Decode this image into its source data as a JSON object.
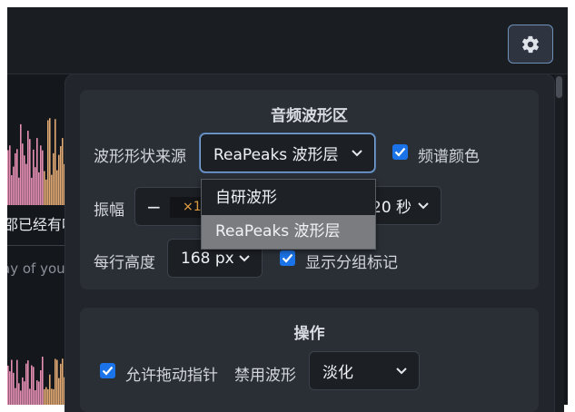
{
  "toolbar": {
    "settings_icon": "gear-icon"
  },
  "background": {
    "line1": "邵已经有听",
    "line2": "ay of you"
  },
  "waveform_section": {
    "title": "音频波形区",
    "source_label": "波形形状来源",
    "source_value": "ReaPeaks 波形层",
    "spectrum_color_label": "频谱颜色",
    "spectrum_color_checked": true,
    "amplitude_label": "振幅",
    "amplitude_minus": "−",
    "amplitude_value": "×1",
    "duration_value": "20 秒",
    "row_height_label": "每行高度",
    "row_height_value": "168 px",
    "group_markers_label": "显示分组标记",
    "group_markers_checked": true
  },
  "source_dropdown": {
    "options": [
      "自研波形",
      "ReaPeaks 波形层"
    ],
    "highlighted": "ReaPeaks 波形层"
  },
  "actions_section": {
    "title": "操作",
    "allow_drag_label": "允许拖动指针",
    "allow_drag_checked": true,
    "disabled_wave_label": "禁用波形",
    "disabled_wave_value": "淡化"
  },
  "colors": {
    "accent": "#1a73e8",
    "focus_border": "#7ea6d8",
    "amplitude_value": "#e8a343",
    "waveform_pink": "#e58fb5",
    "waveform_orange": "#e0a872"
  }
}
